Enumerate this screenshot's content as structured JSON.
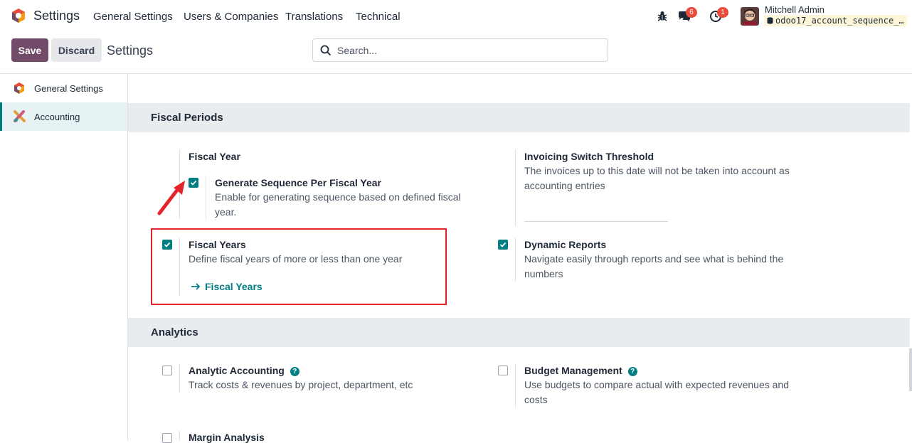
{
  "navbar": {
    "title": "Settings",
    "menus": [
      "General Settings",
      "Users & Companies",
      "Translations",
      "Technical"
    ],
    "messages_count": "6",
    "activities_count": "1",
    "user_name": "Mitchell Admin",
    "database": "odoo17_account_sequence_…"
  },
  "control_panel": {
    "save_label": "Save",
    "discard_label": "Discard",
    "breadcrumb": "Settings",
    "search_placeholder": "Search..."
  },
  "sidebar": {
    "items": [
      {
        "label": "General Settings",
        "icon": "odoo-logo-icon"
      },
      {
        "label": "Accounting",
        "icon": "accounting-app-icon",
        "active": true
      }
    ]
  },
  "sections": {
    "fiscal_periods": {
      "title": "Fiscal Periods",
      "fiscal_year_label": "Fiscal Year",
      "generate_sequence": {
        "title": "Generate Sequence Per Fiscal Year",
        "desc1": "Enable for generating sequence based on defined fiscal",
        "desc2": "year.",
        "checked": true
      },
      "invoicing_threshold": {
        "title": "Invoicing Switch Threshold",
        "desc1": "The invoices up to this date will not be taken into account as",
        "desc2": "accounting entries"
      },
      "fiscal_years": {
        "title": "Fiscal Years",
        "desc": "Define fiscal years of more or less than one year",
        "link": "Fiscal Years",
        "checked": true
      },
      "dynamic_reports": {
        "title": "Dynamic Reports",
        "desc1": "Navigate easily through reports and see what is behind the",
        "desc2": "numbers",
        "checked": true
      }
    },
    "analytics": {
      "title": "Analytics",
      "analytic_accounting": {
        "title": "Analytic Accounting",
        "desc": "Track costs & revenues by project, department, etc",
        "checked": false
      },
      "budget_management": {
        "title": "Budget Management",
        "desc1": "Use budgets to compare actual with expected revenues and",
        "desc2": "costs",
        "checked": false
      },
      "margin_analysis": {
        "title": "Margin Analysis",
        "checked": false
      }
    }
  },
  "colors": {
    "primary": "#714b67",
    "accent": "#017e84",
    "highlight_box": "#e3242b",
    "badge": "#e74c3c"
  }
}
